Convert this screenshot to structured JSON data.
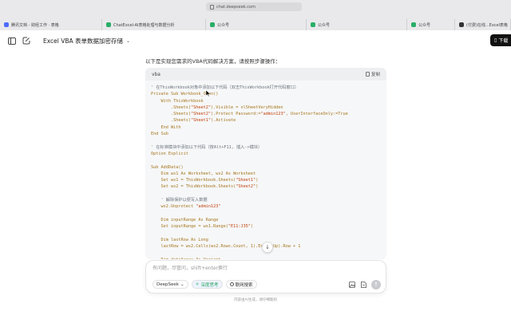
{
  "browser": {
    "url": "chat.deepseek.com",
    "tabs": [
      {
        "label": "腾讯文档 - 财经工作 · 表格",
        "favicon": "blue",
        "active": false
      },
      {
        "label": "ChatExcel-AI表格处理与数据分析",
        "favicon": "green",
        "active": false
      },
      {
        "label": "公众号",
        "favicon": "green",
        "active": false
      },
      {
        "label": "公众号",
        "favicon": "green",
        "active": false
      },
      {
        "label": "公众号",
        "favicon": "green",
        "active": false
      },
      {
        "label": "(付费)在线...Excel表格",
        "favicon": "dark",
        "active": false
      }
    ]
  },
  "header": {
    "title": "Excel VBA 表单数据加密存储",
    "download_label": "下载"
  },
  "message": {
    "intro": "以下是实现您需求的VBA代码解决方案，请按照步骤操作："
  },
  "code_block": {
    "language": "vba",
    "copy_label": "复制",
    "lines": [
      [
        {
          "t": "' 在ThisWorkbook对象中添加以下代码（双击ThisWorkbook打开代码窗口）",
          "c": "cmt"
        }
      ],
      [
        {
          "t": "Private Sub Workbook_Open()",
          "c": "kw"
        }
      ],
      [
        {
          "t": "    With ThisWorkbook",
          "c": "kw"
        }
      ],
      [
        {
          "t": "        .Sheets(",
          "c": "kw"
        },
        {
          "t": "\"Sheet2\"",
          "c": "str"
        },
        {
          "t": ").Visible = xlSheetVeryHidden",
          "c": "kw"
        }
      ],
      [
        {
          "t": "        .Sheets(",
          "c": "kw"
        },
        {
          "t": "\"Sheet2\"",
          "c": "str"
        },
        {
          "t": ").Protect Password:=",
          "c": "kw"
        },
        {
          "t": "\"admin123\"",
          "c": "str"
        },
        {
          "t": ", UserInterfaceOnly:=True",
          "c": "kw"
        }
      ],
      [
        {
          "t": "        .Sheets(",
          "c": "kw"
        },
        {
          "t": "\"Sheet1\"",
          "c": "str"
        },
        {
          "t": ").Activate",
          "c": "kw"
        }
      ],
      [
        {
          "t": "    End With",
          "c": "kw"
        }
      ],
      [
        {
          "t": "End Sub",
          "c": "kw"
        }
      ],
      [
        {
          "t": "",
          "c": ""
        }
      ],
      [
        {
          "t": "' 在标准模块中添加以下代码（按Alt+F11, 插入->模块）",
          "c": "cmt"
        }
      ],
      [
        {
          "t": "Option Explicit",
          "c": "kw"
        }
      ],
      [
        {
          "t": "",
          "c": ""
        }
      ],
      [
        {
          "t": "Sub AddData()",
          "c": "kw"
        }
      ],
      [
        {
          "t": "    Dim ws1 As Worksheet, ws2 As Worksheet",
          "c": "kw"
        }
      ],
      [
        {
          "t": "    Set ws1 = ThisWorkbook.Sheets(",
          "c": "kw"
        },
        {
          "t": "\"Sheet1\"",
          "c": "str"
        },
        {
          "t": ")",
          "c": "kw"
        }
      ],
      [
        {
          "t": "    Set ws2 = ThisWorkbook.Sheets(",
          "c": "kw"
        },
        {
          "t": "\"Sheet2\"",
          "c": "str"
        },
        {
          "t": ")",
          "c": "kw"
        }
      ],
      [
        {
          "t": "",
          "c": ""
        }
      ],
      [
        {
          "t": "    ' 解除保护以便写入数据",
          "c": "cmt"
        }
      ],
      [
        {
          "t": "    ws2.Unprotect ",
          "c": "kw"
        },
        {
          "t": "\"admin123\"",
          "c": "str"
        }
      ],
      [
        {
          "t": "",
          "c": ""
        }
      ],
      [
        {
          "t": "    Dim inputRange As Range",
          "c": "kw"
        }
      ],
      [
        {
          "t": "    Set inputRange = ws1.Range(",
          "c": "kw"
        },
        {
          "t": "\"E11:J35\"",
          "c": "str"
        },
        {
          "t": ")",
          "c": "kw"
        }
      ],
      [
        {
          "t": "",
          "c": ""
        }
      ],
      [
        {
          "t": "    Dim lastRow As Long",
          "c": "kw"
        }
      ],
      [
        {
          "t": "    lastRow = ws2.Cells(ws2.Rows.Count, 1).End(xlUp).Row + 1",
          "c": "kw"
        }
      ],
      [
        {
          "t": "",
          "c": ""
        }
      ],
      [
        {
          "t": "    Dim dataArray As Variant",
          "c": "kw"
        }
      ]
    ]
  },
  "composer": {
    "placeholder": "有问题，尽管问，shift+enter换行",
    "model_label": "DeepSeek",
    "deep_think_label": "深度思考",
    "web_search_label": "联网搜索",
    "footer_note": "内容由AI生成，请仔细甄别"
  }
}
